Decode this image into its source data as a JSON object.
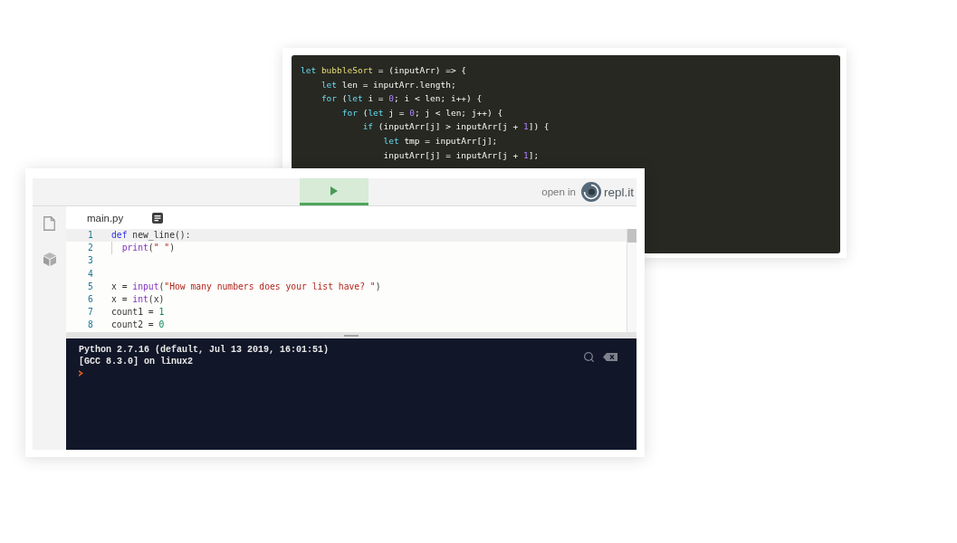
{
  "code_snippet": {
    "lines": [
      {
        "tokens": [
          {
            "kind": "keyword",
            "text": "let"
          },
          {
            "kind": "function",
            "text": " bubbleSort"
          },
          {
            "kind": "plain",
            "text": " = (inputArr) => {"
          }
        ],
        "children": [
          {
            "tokens": [
              {
                "kind": "keyword",
                "text": "let"
              },
              {
                "kind": "plain",
                "text": " len = inputArr.length;"
              }
            ]
          },
          {
            "tokens": [
              {
                "kind": "keyword",
                "text": "for"
              },
              {
                "kind": "plain",
                "text": " ("
              },
              {
                "kind": "keyword",
                "text": "let"
              },
              {
                "kind": "plain",
                "text": " i = "
              },
              {
                "kind": "number",
                "text": "0"
              },
              {
                "kind": "plain",
                "text": "; i < len; i++) {"
              }
            ],
            "children": [
              {
                "tokens": [
                  {
                    "kind": "keyword",
                    "text": "for"
                  },
                  {
                    "kind": "plain",
                    "text": " ("
                  },
                  {
                    "kind": "keyword",
                    "text": "let"
                  },
                  {
                    "kind": "plain",
                    "text": " j = "
                  },
                  {
                    "kind": "number",
                    "text": "0"
                  },
                  {
                    "kind": "plain",
                    "text": "; j < len; j++) {"
                  }
                ],
                "children": [
                  {
                    "tokens": [
                      {
                        "kind": "keyword",
                        "text": "if"
                      },
                      {
                        "kind": "plain",
                        "text": " (inputArr[j] > inputArr[j + "
                      },
                      {
                        "kind": "number",
                        "text": "1"
                      },
                      {
                        "kind": "plain",
                        "text": "]) {"
                      }
                    ],
                    "children": [
                      {
                        "tokens": [
                          {
                            "kind": "keyword",
                            "text": "let"
                          },
                          {
                            "kind": "plain",
                            "text": " tmp = inputArr[j];"
                          }
                        ]
                      },
                      {
                        "tokens": [
                          {
                            "kind": "plain",
                            "text": "inputArr[j] = inputArr[j + "
                          },
                          {
                            "kind": "number",
                            "text": "1"
                          },
                          {
                            "kind": "plain",
                            "text": "];"
                          }
                        ]
                      }
                    ]
                  }
                ]
              }
            ]
          }
        ]
      }
    ]
  },
  "repl": {
    "toolbar": {
      "open_in": "open in",
      "logo_text": "repl.it"
    },
    "tab": {
      "label": "main.py"
    },
    "editor": {
      "lines": [
        {
          "number": "1",
          "active": true,
          "tokens": [
            {
              "kind": "keyword",
              "text": "def"
            },
            {
              "kind": "plain",
              "text": " new_line():"
            }
          ],
          "children": [
            {
              "number": "2",
              "active": false,
              "tokens": [
                {
                  "kind": "builtin",
                  "text": "print"
                },
                {
                  "kind": "plain",
                  "text": "("
                },
                {
                  "kind": "string",
                  "text": "\" \""
                },
                {
                  "kind": "plain",
                  "text": ")"
                }
              ]
            }
          ]
        },
        {
          "number": "3",
          "active": false
        },
        {
          "number": "4",
          "active": false
        },
        {
          "number": "5",
          "active": false,
          "tokens": [
            {
              "kind": "plain",
              "text": "x = "
            },
            {
              "kind": "builtin",
              "text": "input"
            },
            {
              "kind": "plain",
              "text": "("
            },
            {
              "kind": "string",
              "text": "\"How many numbers does your list have? \""
            },
            {
              "kind": "plain",
              "text": ")"
            }
          ]
        },
        {
          "number": "6",
          "active": false,
          "tokens": [
            {
              "kind": "plain",
              "text": "x = "
            },
            {
              "kind": "builtin",
              "text": "int"
            },
            {
              "kind": "plain",
              "text": "(x)"
            }
          ]
        },
        {
          "number": "7",
          "active": false,
          "tokens": [
            {
              "kind": "plain",
              "text": "count1 = "
            },
            {
              "kind": "number",
              "text": "1"
            }
          ]
        },
        {
          "number": "8",
          "active": false,
          "tokens": [
            {
              "kind": "plain",
              "text": "count2 = "
            },
            {
              "kind": "number",
              "text": "0"
            }
          ]
        }
      ]
    },
    "console": {
      "lines": [
        "Python 2.7.16 (default, Jul 13 2019, 16:01:51)",
        "[GCC 8.3.0] on linux2"
      ]
    }
  }
}
